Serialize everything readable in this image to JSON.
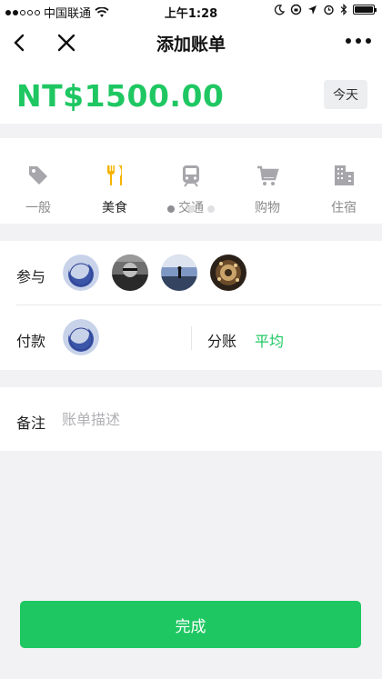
{
  "status_bar": {
    "carrier": "中国联通",
    "time": "上午1:28"
  },
  "nav": {
    "title": "添加账单",
    "back_icon": "chevron-left-icon",
    "close_icon": "close-icon",
    "more_icon": "more-dots-icon"
  },
  "amount": {
    "value": "NT$1500.00",
    "today_label": "今天"
  },
  "categories": {
    "items": [
      {
        "label": "一般",
        "icon": "tag-icon"
      },
      {
        "label": "美食",
        "icon": "fork-knife-icon",
        "active": true
      },
      {
        "label": "交通",
        "icon": "train-icon"
      },
      {
        "label": "购物",
        "icon": "cart-icon"
      },
      {
        "label": "住宿",
        "icon": "building-icon"
      }
    ],
    "pages": 3,
    "current_page": 1
  },
  "participants": {
    "label": "参与",
    "avatars": [
      "avatar-1",
      "avatar-2",
      "avatar-3",
      "avatar-4"
    ]
  },
  "payment": {
    "label": "付款",
    "split_label": "分账",
    "split_value": "平均"
  },
  "note": {
    "label": "备注",
    "placeholder": "账单描述",
    "value": ""
  },
  "done_label": "完成",
  "colors": {
    "accent": "#1fc762",
    "background": "#f2f2f4",
    "active_icon": "#f5b400",
    "inactive_icon": "#a6a6ab"
  }
}
